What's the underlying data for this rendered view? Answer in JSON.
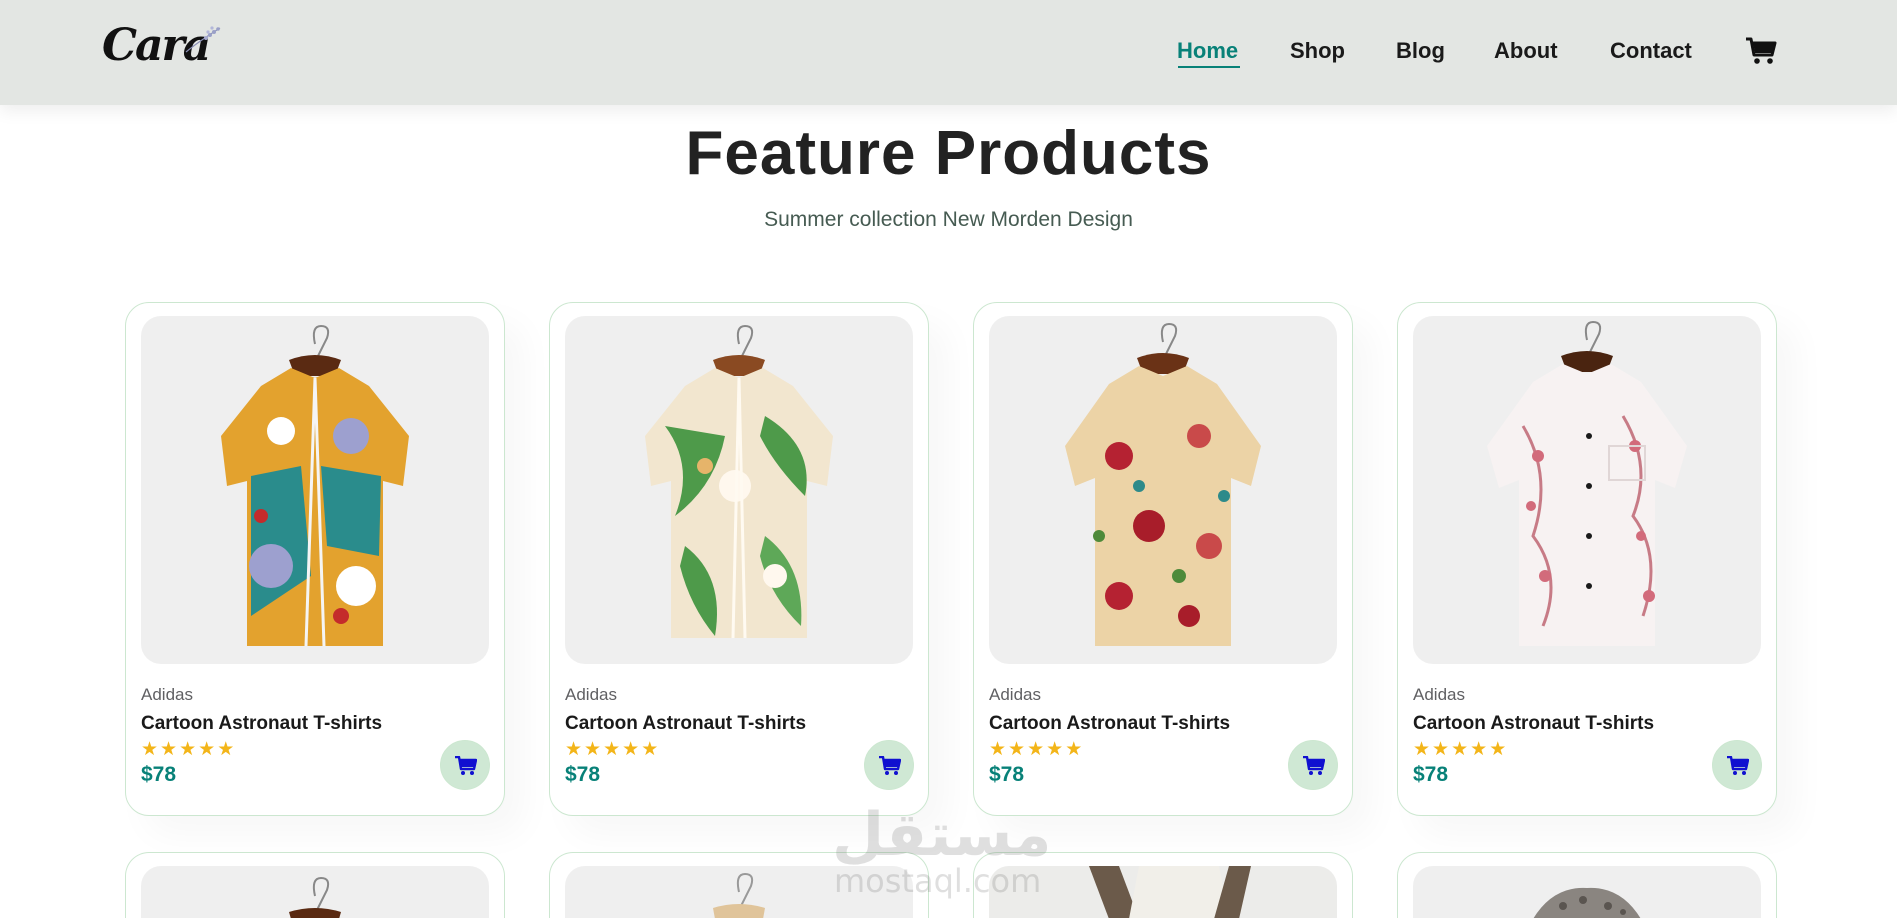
{
  "header": {
    "logo_text": "Cara",
    "nav": [
      {
        "label": "Home",
        "active": true
      },
      {
        "label": "Shop",
        "active": false
      },
      {
        "label": "Blog",
        "active": false
      },
      {
        "label": "About",
        "active": false
      },
      {
        "label": "Contact",
        "active": false
      }
    ],
    "cart_icon": "cart-icon"
  },
  "section": {
    "title": "Feature Products",
    "subtitle": "Summer collection New Morden Design"
  },
  "products": [
    {
      "brand": "Adidas",
      "name": "Cartoon Astronaut T-shirts",
      "rating": 5,
      "price": "$78",
      "image": "shirt-abstract-floral"
    },
    {
      "brand": "Adidas",
      "name": "Cartoon Astronaut T-shirts",
      "rating": 5,
      "price": "$78",
      "image": "shirt-green-lily"
    },
    {
      "brand": "Adidas",
      "name": "Cartoon Astronaut T-shirts",
      "rating": 5,
      "price": "$78",
      "image": "shirt-red-roses"
    },
    {
      "brand": "Adidas",
      "name": "Cartoon Astronaut T-shirts",
      "rating": 5,
      "price": "$78",
      "image": "shirt-pink-blossom"
    }
  ],
  "watermark": {
    "arabic": "مستقل",
    "latin": "mostaql.com"
  },
  "colors": {
    "accent": "#088178",
    "header_bg": "#e3e6e3",
    "star": "#f3b519",
    "cart_button_bg": "#cfe8d4",
    "cart_icon_blue": "#1010d0"
  }
}
